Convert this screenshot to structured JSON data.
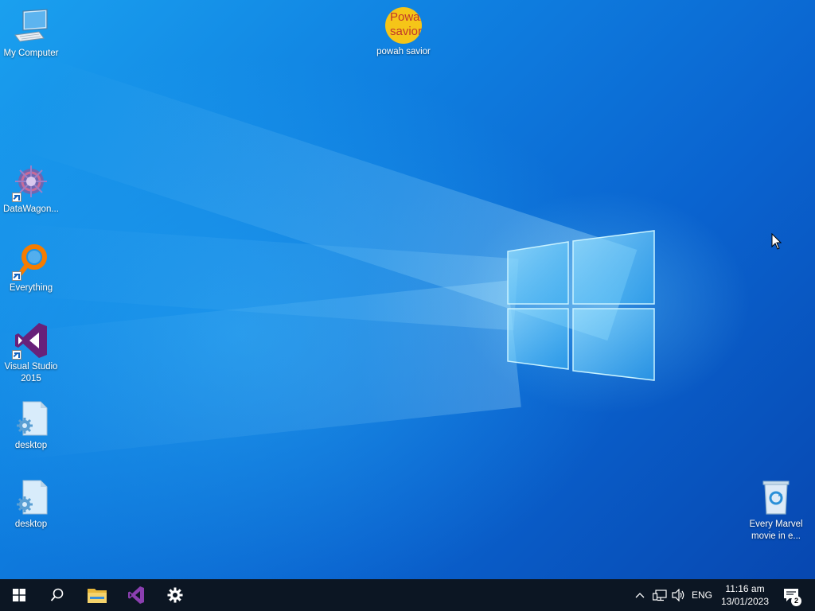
{
  "desktop": {
    "icons": [
      {
        "label": "My Computer",
        "icon": "computer-icon"
      },
      {
        "label": "powah savior",
        "icon": "yellow-circle-icon",
        "glyph_text": "Powah savior"
      },
      {
        "label": "DataWagon...",
        "icon": "gear-app-icon",
        "shortcut": true
      },
      {
        "label": "Everything",
        "icon": "magnifier-icon",
        "shortcut": true
      },
      {
        "label": "Visual Studio 2015",
        "icon": "visual-studio-icon",
        "shortcut": true
      },
      {
        "label": "desktop",
        "icon": "config-file-icon"
      },
      {
        "label": "desktop",
        "icon": "config-file-icon"
      },
      {
        "label": "Every Marvel movie in e...",
        "icon": "recycle-bin-icon"
      }
    ]
  },
  "taskbar": {
    "pinned": [
      {
        "name": "Start",
        "icon": "windows-start-icon"
      },
      {
        "name": "Search",
        "icon": "search-icon"
      },
      {
        "name": "File Explorer",
        "icon": "folder-icon"
      },
      {
        "name": "Visual Studio",
        "icon": "visual-studio-icon"
      },
      {
        "name": "Settings",
        "icon": "gear-icon"
      }
    ],
    "tray": {
      "language": "ENG",
      "time": "11:16 am",
      "date": "13/01/2023",
      "notification_count": "2"
    }
  },
  "colors": {
    "taskbar": "#0c1623",
    "wallpaper_primary": "#0f7fe0",
    "vs_purple": "#68217a",
    "everything_orange": "#f57c00",
    "powah_yellow": "#f5c518"
  }
}
